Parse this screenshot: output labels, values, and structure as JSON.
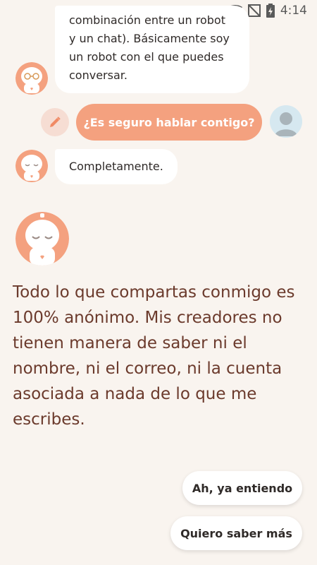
{
  "status_bar": {
    "time": "4:14"
  },
  "messages": {
    "bot_intro": [
      "combinación entre un robot",
      "y un chat). Básicamente soy",
      "un robot con el que puedes",
      "conversar."
    ],
    "user_question": "¿Es seguro hablar contigo?",
    "bot_reply": "Completamente.",
    "bot_long": "Todo lo que compartas conmigo es 100% anónimo. Mis creadores no tienen manera de saber ni el nombre, ni el correo, ni la cuenta asociada a nada de lo que me escribes."
  },
  "quick_replies": {
    "first": "Ah, ya entiendo",
    "second": "Quiero saber más"
  },
  "colors": {
    "accent": "#f4a17f",
    "background": "#f9f4ef",
    "text_brown": "#6b3a2c"
  }
}
